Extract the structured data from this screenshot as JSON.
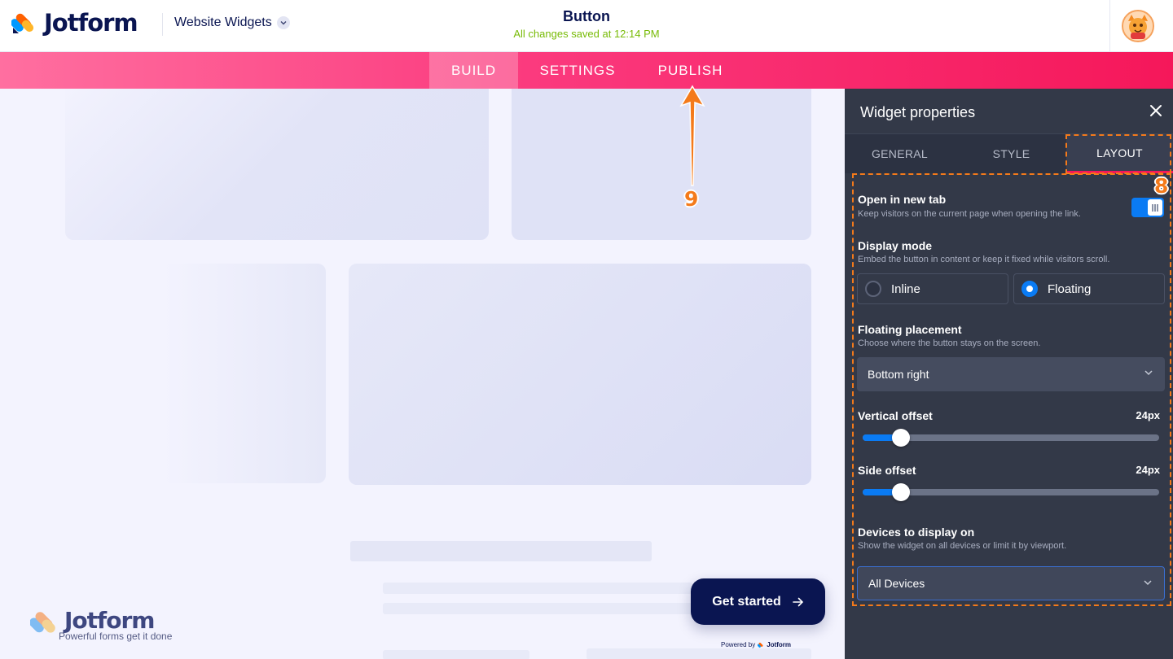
{
  "header": {
    "logo_text": "Jotform",
    "product_name": "Website Widgets",
    "title": "Button",
    "save_status": "All changes saved at 12:14 PM"
  },
  "nav": {
    "tabs": [
      {
        "label": "BUILD",
        "active": true
      },
      {
        "label": "SETTINGS",
        "active": false
      },
      {
        "label": "PUBLISH",
        "active": false
      }
    ]
  },
  "canvas": {
    "watermark_title": "Jotform",
    "watermark_tagline": "Powerful forms get it done",
    "cta_label": "Get started",
    "powered_prefix": "Powered by",
    "powered_brand": "Jotform"
  },
  "panel": {
    "title": "Widget properties",
    "tabs": [
      {
        "label": "GENERAL",
        "active": false
      },
      {
        "label": "STYLE",
        "active": false
      },
      {
        "label": "LAYOUT",
        "active": true
      }
    ],
    "open_new_tab": {
      "label": "Open in new tab",
      "description": "Keep visitors on the current page when opening the link.",
      "enabled": true
    },
    "display_mode": {
      "label": "Display mode",
      "description": "Embed the button in content or keep it fixed while visitors scroll.",
      "options": [
        "Inline",
        "Floating"
      ],
      "selected": "Floating"
    },
    "floating_placement": {
      "label": "Floating placement",
      "description": "Choose where the button stays on the screen.",
      "value": "Bottom right"
    },
    "vertical_offset": {
      "label": "Vertical offset",
      "value_text": "24px",
      "level": 0.13
    },
    "side_offset": {
      "label": "Side offset",
      "value_text": "24px",
      "level": 0.13
    },
    "devices": {
      "label": "Devices to display on",
      "description": "Show the widget on all devices or limit it by viewport.",
      "value": "All Devices"
    }
  },
  "annotations": {
    "step_8": "8",
    "step_9": "9"
  },
  "colors": {
    "brand_navy": "#0a1551",
    "nav_pink": "#f5175a",
    "accent_blue": "#0a7bf4",
    "annotation_orange": "#f47a1a",
    "saved_green": "#78bb07"
  }
}
